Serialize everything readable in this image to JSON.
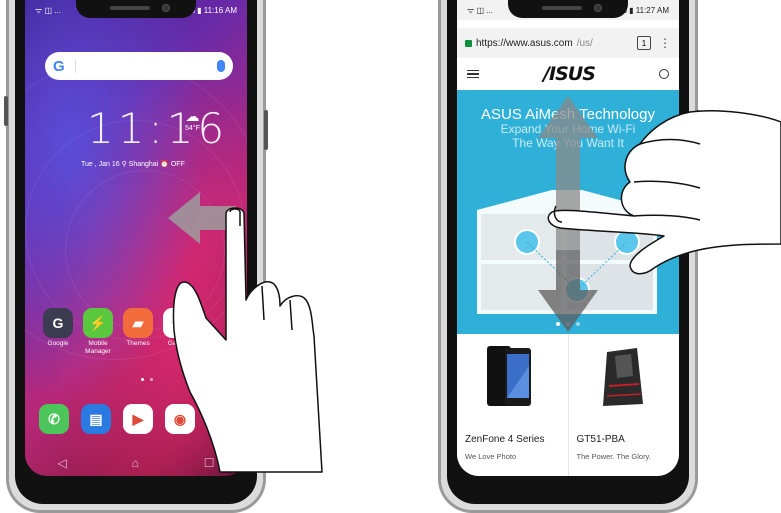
{
  "left_phone": {
    "status": {
      "left": "ᯤ ◫ ...",
      "right": "86% ▮ 11:16 AM"
    },
    "search": {
      "logo": "G"
    },
    "clock": {
      "time": "11:16",
      "temp": "54°F"
    },
    "date_line": "Tue , Jan 16  ⚲ Shanghai  ⏰ OFF",
    "dock_row": [
      {
        "label": "Google",
        "color": "#3b3b52",
        "glyph": "G"
      },
      {
        "label": "Mobile\nManager",
        "color": "#5ac83e",
        "glyph": "⚡"
      },
      {
        "label": "Themes",
        "color": "#f26b3a",
        "glyph": "▰"
      },
      {
        "label": "Gallery",
        "color": "#ffffff",
        "glyph": "✿"
      }
    ],
    "bottom_row": [
      {
        "name": "phone",
        "color": "#4cc55a",
        "glyph": "✆"
      },
      {
        "name": "messages",
        "color": "#2a7ae0",
        "glyph": "▤"
      },
      {
        "name": "play-store",
        "color": "#ffffff",
        "glyph": "▶"
      },
      {
        "name": "chrome",
        "color": "#ffffff",
        "glyph": "◉"
      },
      {
        "name": "camera",
        "color": "#2a7ae0",
        "glyph": "◙"
      }
    ],
    "nav": {
      "back": "◁",
      "home": "⌂",
      "recent": "☐"
    }
  },
  "right_phone": {
    "status": {
      "left": "ᯤ ◫ ...",
      "right": "85% ▮ 11:27 AM"
    },
    "url": {
      "host": "https://www.asus.com",
      "path": "/us/",
      "tabs": "1",
      "menu": "⋮"
    },
    "brand": "/ISUS",
    "hero": {
      "title": "ASUS AiMesh Technology",
      "subtitle": "Expand Your Home Wi-Fi\nThe Way You Want It"
    },
    "products": [
      {
        "name": "ZenFone 4 Series",
        "tagline": "We Love Photo"
      },
      {
        "name": "GT51-PBA",
        "tagline": "The Power. The Glory."
      }
    ]
  },
  "colors": {
    "hero_blue": "#2fb0d8",
    "url_green": "#0a8f3c"
  }
}
